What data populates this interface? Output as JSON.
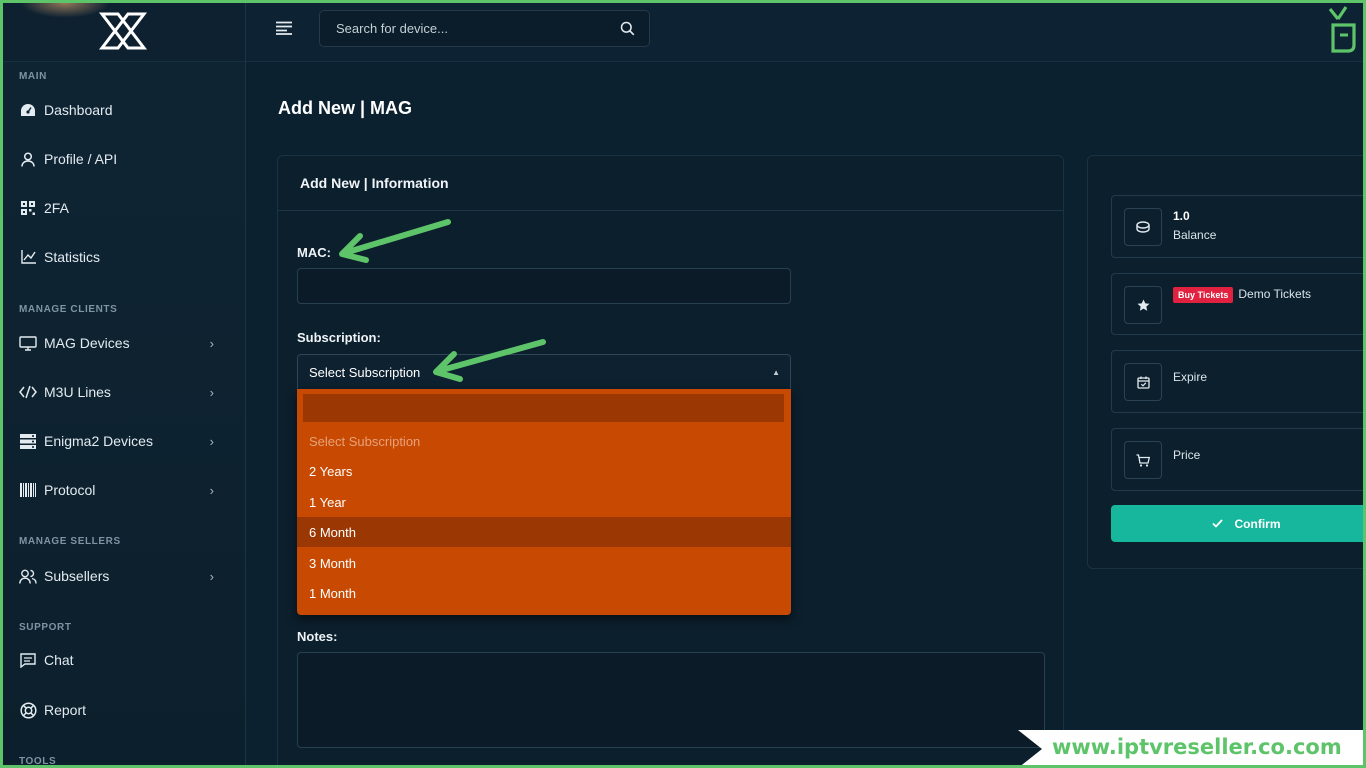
{
  "sidebar": {
    "sections": {
      "main": "MAIN",
      "manage_clients": "MANAGE CLIENTS",
      "manage_sellers": "MANAGE SELLERS",
      "support": "SUPPORT",
      "tools": "TOOLS"
    },
    "items": {
      "dashboard": "Dashboard",
      "profile": "Profile / API",
      "twofa": "2FA",
      "statistics": "Statistics",
      "mag": "MAG Devices",
      "m3u": "M3U Lines",
      "enigma": "Enigma2 Devices",
      "protocol": "Protocol",
      "subsellers": "Subsellers",
      "chat": "Chat",
      "report": "Report"
    },
    "icons": [
      "dashboard-icon",
      "user-icon",
      "qr-icon",
      "chart-icon",
      "monitor-icon",
      "code-icon",
      "server-icon",
      "barcode-icon",
      "users-icon",
      "chat-icon",
      "lifebuoy-icon"
    ]
  },
  "header": {
    "search_placeholder": "Search for device..."
  },
  "page": {
    "title": "Add New | MAG",
    "card_title": "Add New | Information",
    "mac_label": "MAC:",
    "subscription_label": "Subscription:",
    "select_value": "Select Subscription",
    "notes_label": "Notes:",
    "options": [
      "Select Subscription",
      "2 Years",
      "1 Year",
      "6 Month",
      "3 Month",
      "1 Month"
    ],
    "hovered_option": "6 Month"
  },
  "summary": {
    "balance_value": "1.0",
    "balance_label": "Balance",
    "buy_badge": "Buy Tickets",
    "tickets_label": "Demo Tickets",
    "expire_label": "Expire",
    "price_label": "Price",
    "confirm_label": "Confirm"
  },
  "watermark": "www.iptvreseller.co.com",
  "colors": {
    "accent": "#16b79c",
    "dropdown": "#c84a02",
    "dropdown_hover": "#9b3703",
    "badge": "#e0213f",
    "annotation": "#5ec46a"
  }
}
